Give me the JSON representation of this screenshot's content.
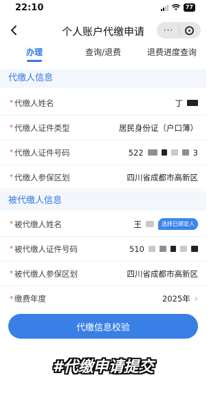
{
  "status_bar": {
    "time": "22:10",
    "battery": "77"
  },
  "nav": {
    "title": "个人账户代缴申请",
    "capsule_menu": "···"
  },
  "tabs": [
    {
      "label": "办理",
      "active": true
    },
    {
      "label": "查询/退费",
      "active": false
    },
    {
      "label": "退费进度查询",
      "active": false
    }
  ],
  "section_payer": {
    "title": "代缴人信息",
    "fields": [
      {
        "label": "代缴人姓名",
        "value": "丁"
      },
      {
        "label": "代缴人证件类型",
        "value": "居民身份证（户口薄）"
      },
      {
        "label": "代缴人证件号码",
        "value_prefix": "522",
        "value_suffix": "3"
      },
      {
        "label": "代缴人参保区划",
        "value": "四川省成都市高新区"
      }
    ]
  },
  "section_payee": {
    "title": "被代缴人信息",
    "fields": [
      {
        "label": "被代缴人姓名",
        "value": "王",
        "badge": "选择已绑定人"
      },
      {
        "label": "被代缴人证件号码",
        "value_prefix": "510"
      },
      {
        "label": "被代缴人参保区划",
        "value": "四川省成都市高新区"
      }
    ]
  },
  "year_field": {
    "label": "缴费年度",
    "value": "2025年"
  },
  "verify_button": "代缴信息校验",
  "overlay_caption": "#代缴申请提交",
  "colors": {
    "accent": "#2f7ae5",
    "required": "#e8473b",
    "section_bg": "#f3f6fb"
  },
  "icons": [
    "back-chevron-icon",
    "more-dots-icon",
    "close-circle-icon",
    "chevron-right-icon"
  ]
}
